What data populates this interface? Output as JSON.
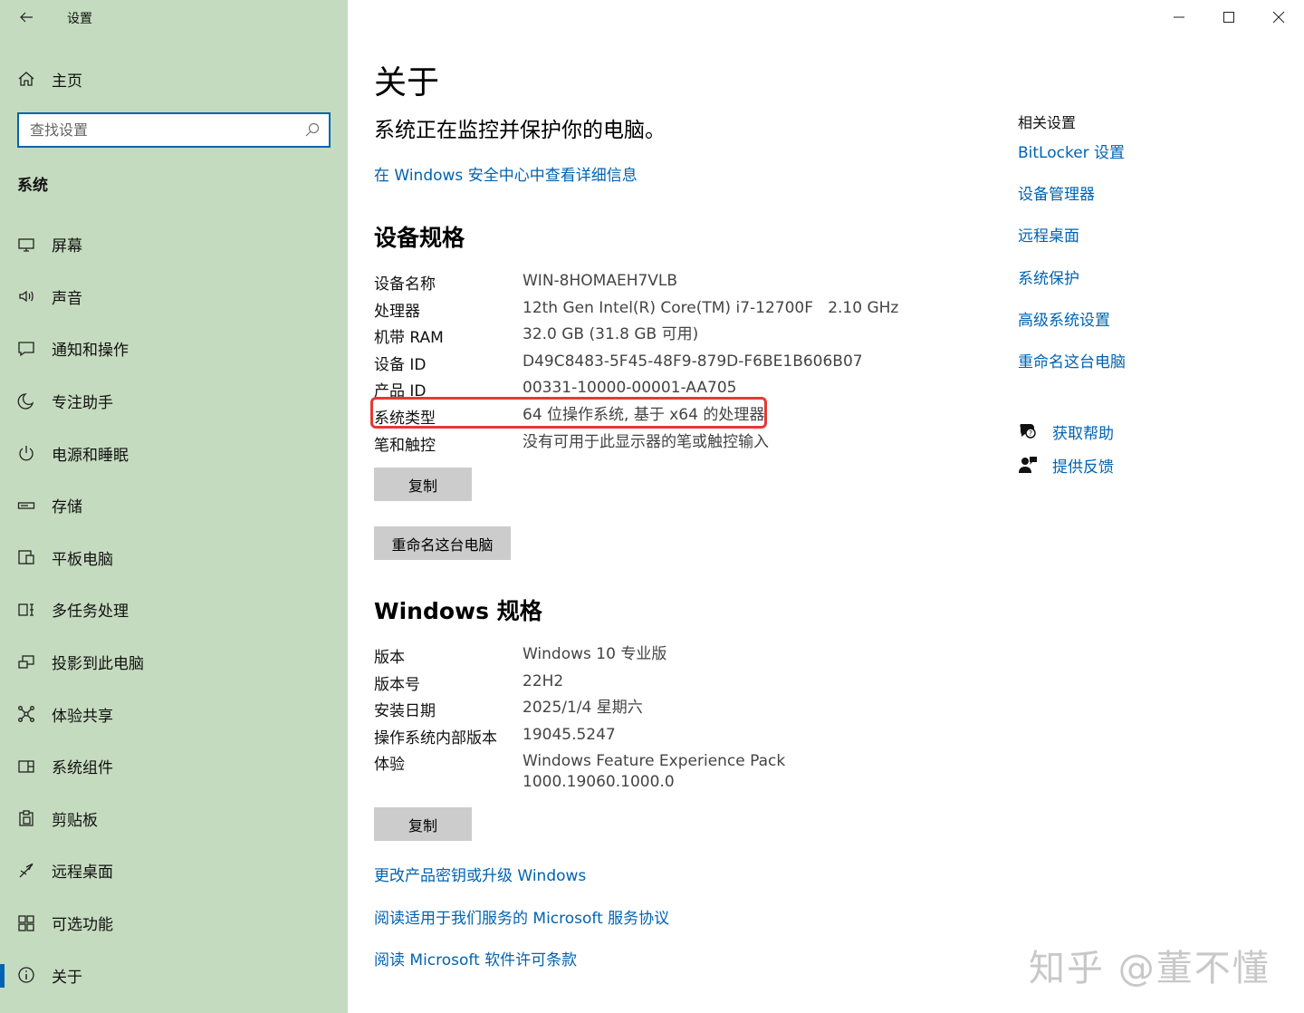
{
  "app": {
    "title": "设置"
  },
  "sidebar": {
    "home_label": "主页",
    "search_placeholder": "查找设置",
    "section_label": "系统",
    "items": [
      {
        "label": "屏幕",
        "icon": "monitor-icon"
      },
      {
        "label": "声音",
        "icon": "speaker-icon"
      },
      {
        "label": "通知和操作",
        "icon": "notification-icon"
      },
      {
        "label": "专注助手",
        "icon": "moon-icon"
      },
      {
        "label": "电源和睡眠",
        "icon": "power-icon"
      },
      {
        "label": "存储",
        "icon": "storage-icon"
      },
      {
        "label": "平板电脑",
        "icon": "tablet-icon"
      },
      {
        "label": "多任务处理",
        "icon": "multitask-icon"
      },
      {
        "label": "投影到此电脑",
        "icon": "project-icon"
      },
      {
        "label": "体验共享",
        "icon": "share-icon"
      },
      {
        "label": "系统组件",
        "icon": "components-icon"
      },
      {
        "label": "剪贴板",
        "icon": "clipboard-icon"
      },
      {
        "label": "远程桌面",
        "icon": "remote-icon"
      },
      {
        "label": "可选功能",
        "icon": "features-icon"
      },
      {
        "label": "关于",
        "icon": "info-icon",
        "active": true
      }
    ]
  },
  "main": {
    "title": "关于",
    "status": "系统正在监控并保护你的电脑。",
    "security_link": "在 Windows 安全中心中查看详细信息",
    "device_specs": {
      "heading": "设备规格",
      "rows": [
        {
          "key": "设备名称",
          "value": "WIN-8HOMAEH7VLB"
        },
        {
          "key": "处理器",
          "value": "12th Gen Intel(R) Core(TM) i7-12700F   2.10 GHz"
        },
        {
          "key": "机带 RAM",
          "value": "32.0 GB (31.8 GB 可用)"
        },
        {
          "key": "设备 ID",
          "value": "D49C8483-5F45-48F9-879D-F6BE1B606B07"
        },
        {
          "key": "产品 ID",
          "value": "00331-10000-00001-AA705"
        },
        {
          "key": "系统类型",
          "value": "64 位操作系统, 基于 x64 的处理器"
        },
        {
          "key": "笔和触控",
          "value": "没有可用于此显示器的笔或触控输入"
        }
      ],
      "copy_label": "复制",
      "rename_label": "重命名这台电脑"
    },
    "windows_specs": {
      "heading": "Windows 规格",
      "rows": [
        {
          "key": "版本",
          "value": "Windows 10 专业版"
        },
        {
          "key": "版本号",
          "value": "22H2"
        },
        {
          "key": "安装日期",
          "value": "2025/1/4 星期六"
        },
        {
          "key": "操作系统内部版本",
          "value": "19045.5247"
        },
        {
          "key": "体验",
          "value": "Windows Feature Experience Pack",
          "value2": "1000.19060.1000.0"
        }
      ],
      "copy_label": "复制"
    },
    "links": [
      "更改产品密钥或升级 Windows",
      "阅读适用于我们服务的 Microsoft 服务协议",
      "阅读 Microsoft 软件许可条款"
    ]
  },
  "related": {
    "title": "相关设置",
    "links": [
      "BitLocker 设置",
      "设备管理器",
      "远程桌面",
      "系统保护",
      "高级系统设置",
      "重命名这台电脑"
    ],
    "help_label": "获取帮助",
    "feedback_label": "提供反馈"
  },
  "watermark": "知乎 @董不懂",
  "colors": {
    "sidebar_bg": "#c5dbbf",
    "accent": "#0063b1",
    "highlight": "#e53935"
  }
}
